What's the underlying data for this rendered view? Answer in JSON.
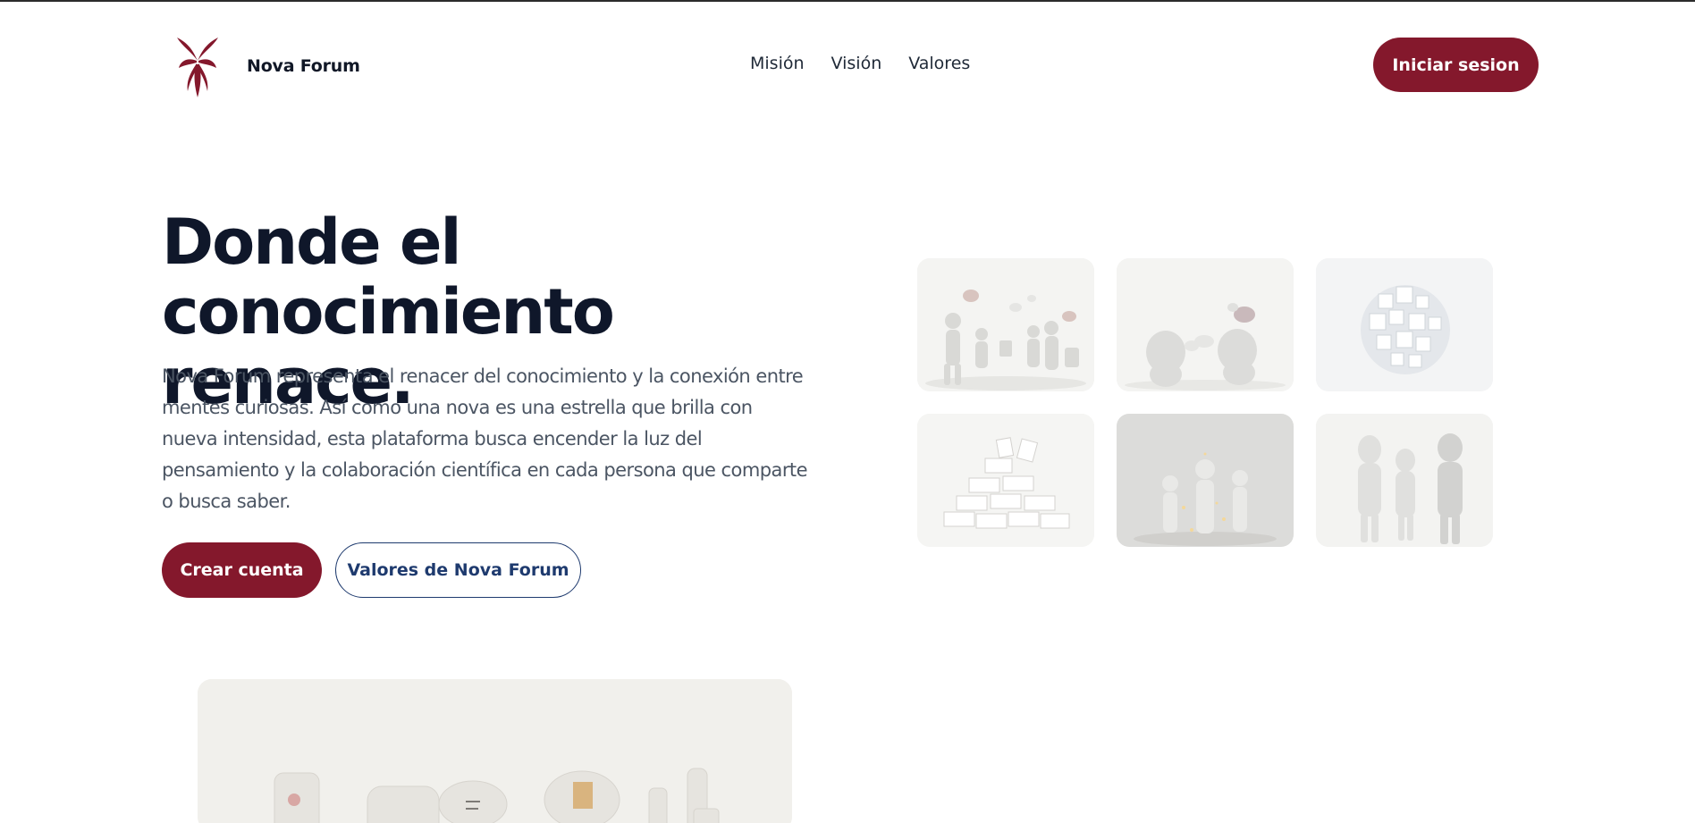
{
  "brand": {
    "name": "Nova Forum",
    "logo_icon": "butterfly-logo-icon",
    "accent": "#84182c"
  },
  "nav": {
    "items": [
      "Misión",
      "Visión",
      "Valores"
    ]
  },
  "header": {
    "login_label": "Iniciar sesion"
  },
  "hero": {
    "title_line1": "Donde el",
    "title_line2": "conocimiento renace.",
    "description": "Nova Forum representa el renacer del conocimiento y la conexión entre mentes curiosas. Así como una nova es una estrella que brilla con nueva intensidad, esta plataforma busca encender la luz del pensamiento y la colaboración científica en cada persona que comparte o busca saber.",
    "primary_cta": "Crear cuenta",
    "secondary_cta": "Valores de Nova Forum"
  },
  "gallery": {
    "tiles": [
      "people-chatting-image",
      "figures-speech-bubbles-image",
      "cubes-cluster-image",
      "stacked-books-image",
      "glowing-figures-image",
      "three-figures-image"
    ]
  },
  "colors": {
    "primary": "#84182c",
    "secondary": "#1e3a6e",
    "heading": "#0f172a",
    "body_text": "#4b5563"
  }
}
